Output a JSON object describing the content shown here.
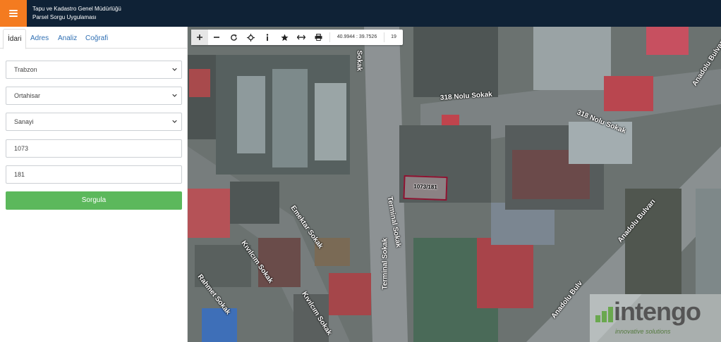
{
  "header": {
    "title": "Tapu ve Kadastro Genel Müdürlüğü",
    "subtitle": "Parsel Sorgu Uygulaması",
    "menu_icon": "hamburger-menu-icon",
    "accent": "#f47b20",
    "bar_color": "#0f2236"
  },
  "tabs": [
    "İdari",
    "Adres",
    "Analiz",
    "Coğrafi"
  ],
  "form": {
    "province": "Trabzon",
    "district": "Ortahisar",
    "neighborhood": "Sanayi",
    "block": "1073",
    "parcel": "181",
    "submit_label": "Sorgula",
    "submit_color": "#5cb85c"
  },
  "map": {
    "toolbar": {
      "icons": [
        "zoom-in-icon",
        "zoom-out-icon",
        "refresh-icon",
        "locate-icon",
        "info-icon",
        "favorite-star-icon",
        "measure-icon",
        "print-icon"
      ],
      "coordinates": "40.9944 : 39.7526",
      "zoom_level": "19"
    },
    "parcel_label": "1073/181",
    "parcel_color": "#8e1230",
    "streets": {
      "s1": "318 Nolu Sokak",
      "s2": "318 Nolu Sokak",
      "s3": "Sokak",
      "s4": "Terminal Sokak",
      "s5": "Terminal Sokak",
      "s6": "Emektar Sokak",
      "s7": "Kıvılcım Sokak",
      "s8": "Kıvılcım Sokak",
      "s9": "Rahmet Sokak",
      "s10": "Anadolu Bulvarı",
      "s11": "Anadolu Bulvarı",
      "s12": "Anadolu Bulv"
    },
    "watermark": {
      "name": "intengo",
      "tagline": "innovative solutions"
    }
  }
}
